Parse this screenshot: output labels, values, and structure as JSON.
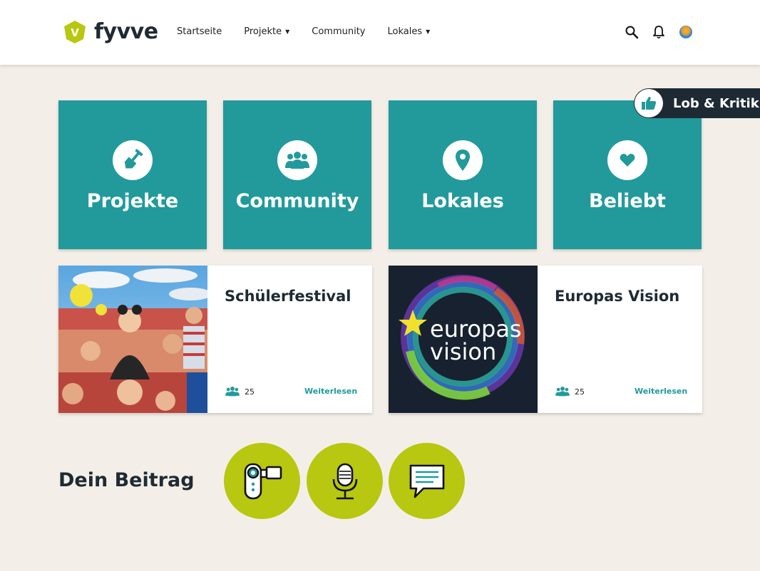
{
  "header": {
    "logo_letter": "V",
    "logo_text": "fyvve",
    "nav": [
      {
        "label": "Startseite",
        "dropdown": false
      },
      {
        "label": "Projekte",
        "dropdown": true
      },
      {
        "label": "Community",
        "dropdown": false
      },
      {
        "label": "Lokales",
        "dropdown": true
      }
    ],
    "icons": [
      "search-icon",
      "bell-icon",
      "avatar"
    ]
  },
  "tiles": [
    {
      "label": "Projekte",
      "icon": "shovel-icon"
    },
    {
      "label": "Community",
      "icon": "group-icon"
    },
    {
      "label": "Lokales",
      "icon": "map-pin-icon"
    },
    {
      "label": "Beliebt",
      "icon": "heart-icon"
    }
  ],
  "feedback": {
    "label": "Lob & Kritik",
    "icon": "thumbs-up-icon"
  },
  "cards": [
    {
      "title": "Schülerfestival",
      "participants": "25",
      "link": "Weiterlesen",
      "image": "festival-crowd-photo"
    },
    {
      "title": "Europas Vision",
      "participants": "25",
      "link": "Weiterlesen",
      "image": "europas-vision-logo",
      "image_text_1": "europas",
      "image_text_2": "vision"
    }
  ],
  "beitrag": {
    "title": "Dein Beitrag",
    "buttons": [
      "video-camera-icon",
      "microphone-icon",
      "chat-bubble-icon"
    ]
  },
  "colors": {
    "teal": "#229a9c",
    "lime": "#b8c70f",
    "dark": "#1f2a33",
    "background": "#f3efe8"
  }
}
